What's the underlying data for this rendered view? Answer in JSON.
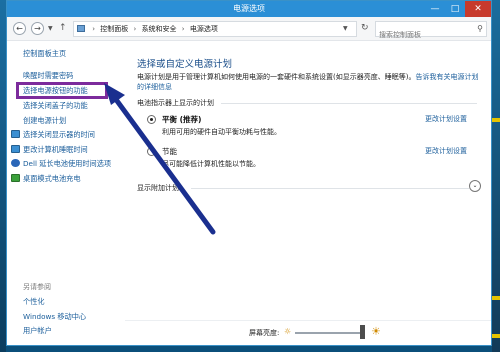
{
  "window": {
    "title": "电源选项",
    "minimize": "—",
    "maximize": "□",
    "close": "✕"
  },
  "nav": {
    "back": "←",
    "forward": "→",
    "up": "↑"
  },
  "breadcrumb": {
    "items": [
      "控制面板",
      "系统和安全",
      "电源选项"
    ],
    "separator": "›"
  },
  "search": {
    "placeholder": "搜索控制面板"
  },
  "sidebar": {
    "home": "控制面板主页",
    "links": [
      "唤醒时需要密码",
      "选择电源按钮的功能",
      "选择关闭盖子的功能",
      "创建电源计划",
      "选择关闭显示器的时间",
      "更改计算机睡眠时间",
      "Dell 延长电池使用时间选项",
      "桌面模式电池充电"
    ],
    "see_also_title": "另请参阅",
    "see_also": [
      "个性化",
      "Windows 移动中心",
      "用户帐户"
    ]
  },
  "main": {
    "heading": "选择或自定义电源计划",
    "description": "电源计划是用于管理计算机如何使用电源的一套硬件和系统设置(如显示器亮度、睡眠等)。",
    "description_link": "告诉我有关电源计划的详细信息",
    "section_label": "电池指示器上显示的计划",
    "plans": [
      {
        "name": "平衡 (推荐)",
        "desc": "利用可用的硬件自动平衡功耗与性能。",
        "link": "更改计划设置",
        "selected": true
      },
      {
        "name": "节能",
        "desc": "尽可能降低计算机性能以节能。",
        "link": "更改计划设置",
        "selected": false
      }
    ],
    "extra_label": "显示附加计划",
    "expand_icon": "⌄"
  },
  "footer": {
    "brightness_label": "屏幕亮度:",
    "brightness_level": 0.95
  },
  "colors": {
    "titlebar": "#2b8fd6",
    "link": "#1b5e9b",
    "highlight": "#7c2b9c",
    "arrow": "#1a2f8f"
  }
}
